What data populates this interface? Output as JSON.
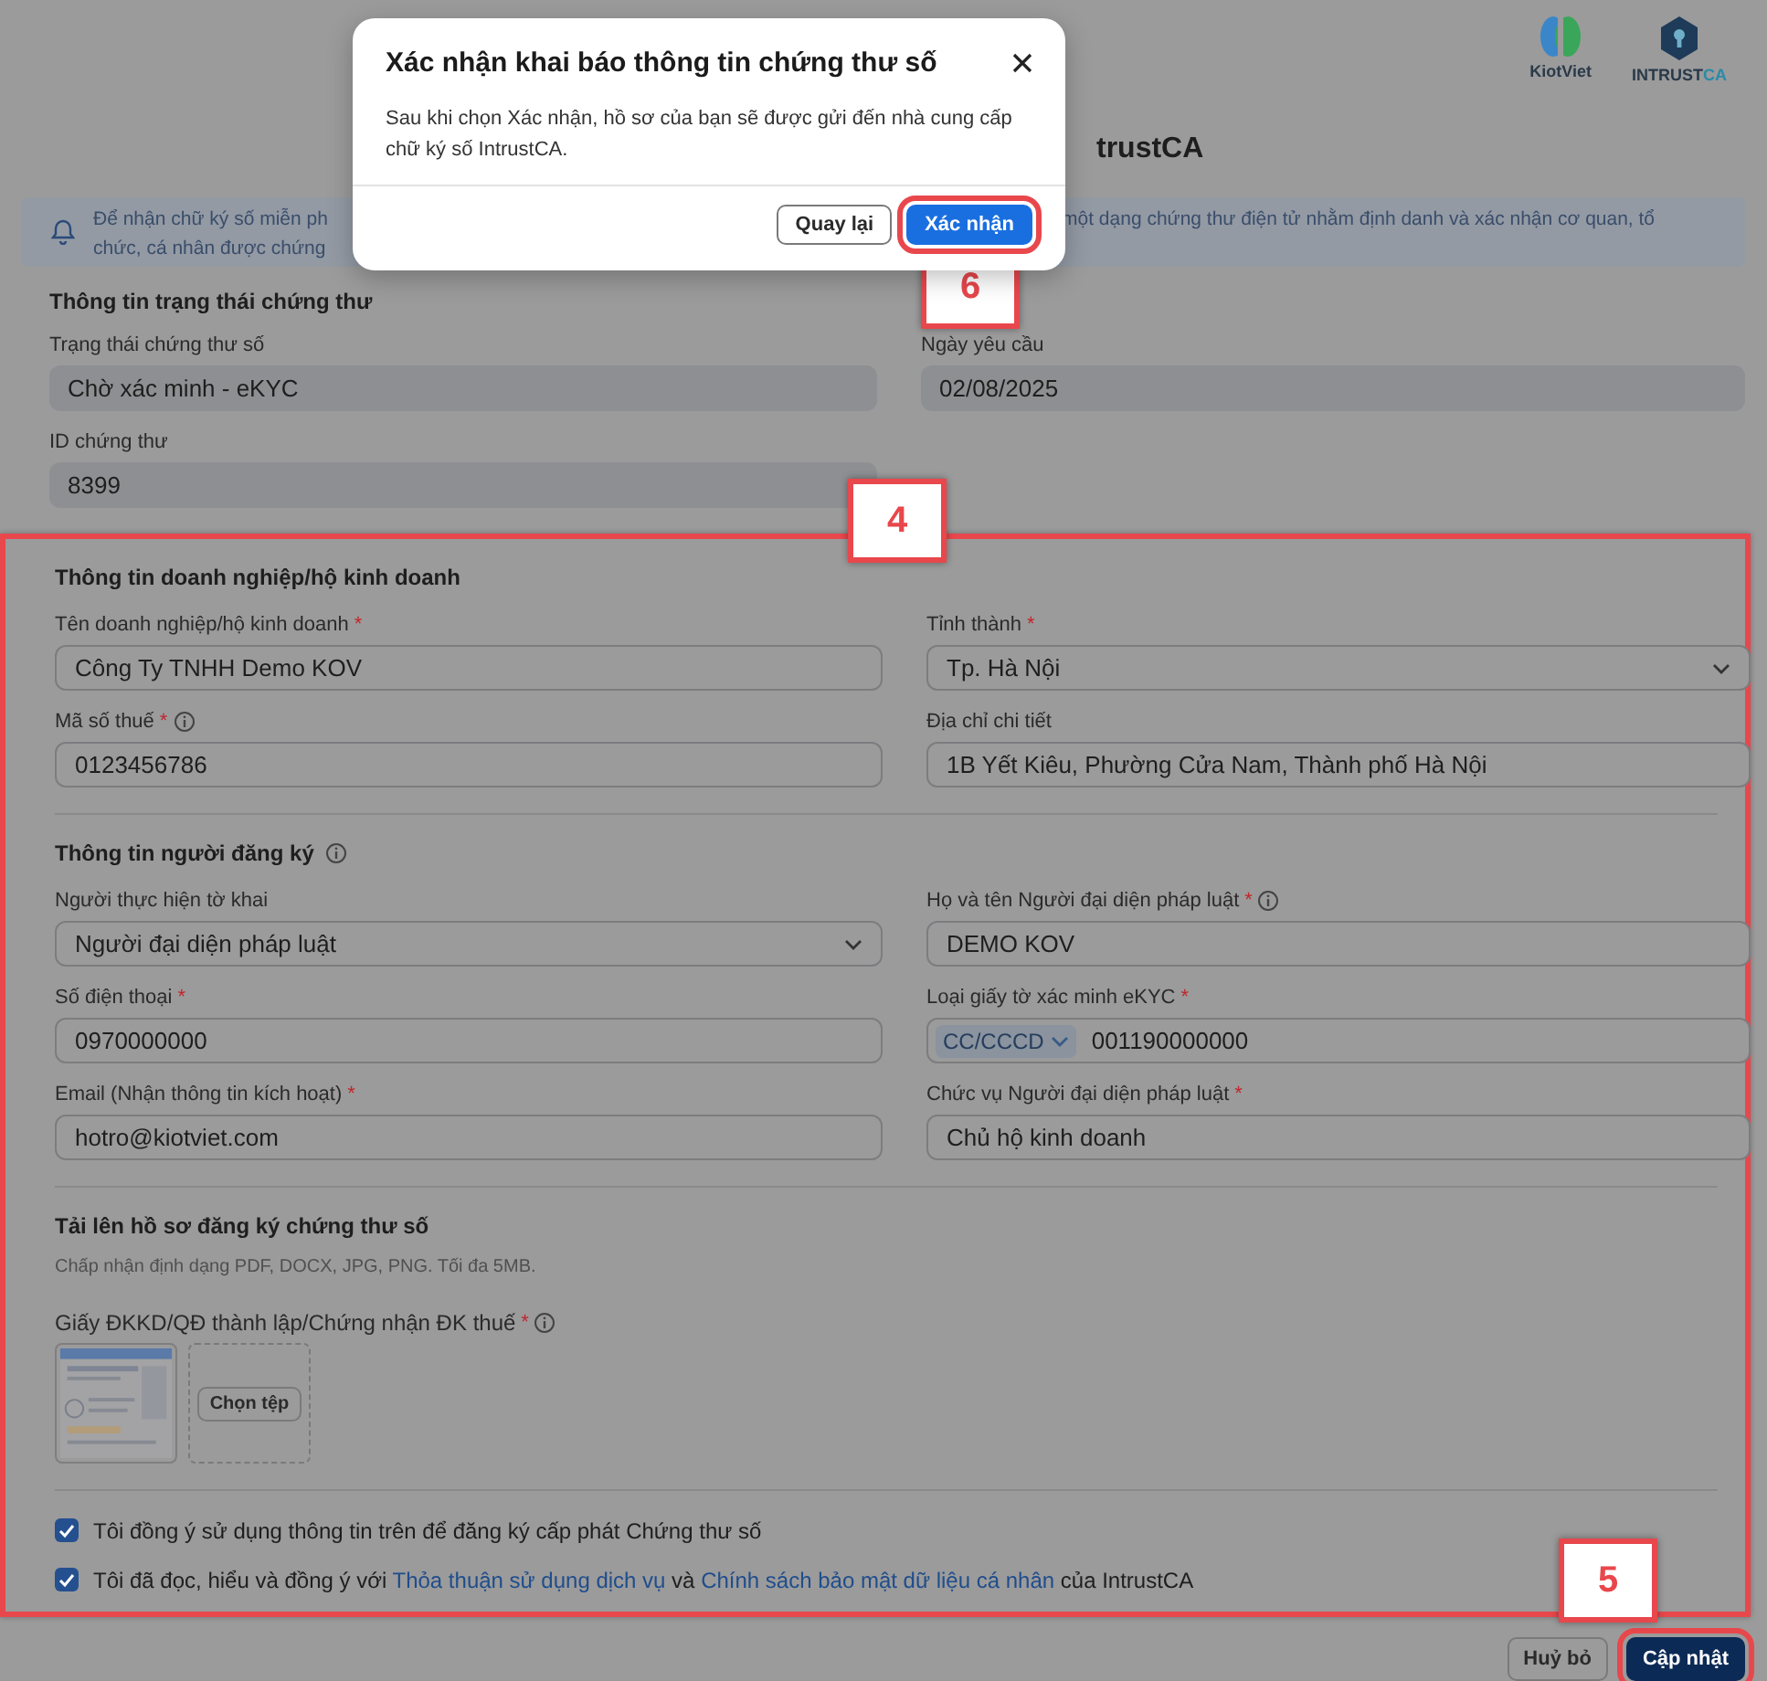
{
  "header": {
    "logos": [
      {
        "kind": "kiotviet",
        "text": "KiotViet"
      },
      {
        "kind": "intrust",
        "text": "INTRUST",
        "accent": "CA"
      }
    ]
  },
  "page_title": "trustCA",
  "notice": {
    "left_lines": [
      "Để nhận chữ ký số miễn ph",
      "chức, cá nhân được chứng"
    ],
    "right_lines": [
      "một dạng chứng thư điện tử nhằm định danh và xác nhận cơ quan, tổ"
    ]
  },
  "status_section": {
    "title": "Thông tin trạng thái chứng thư",
    "fields": [
      {
        "label": "Trạng thái chứng thư số",
        "kind": "readonly",
        "value": "Chờ xác minh - eKYC"
      },
      {
        "label": "Ngày yêu cầu",
        "kind": "readonly",
        "value": "02/08/2025"
      },
      {
        "label": "ID chứng thư",
        "kind": "readonly",
        "value": "8399"
      }
    ]
  },
  "form": {
    "callout": "4",
    "sections": [
      {
        "title": "Thông tin doanh nghiệp/hộ kinh doanh",
        "fields": [
          {
            "label": "Tên doanh nghiệp/hộ kinh doanh",
            "mark": "*",
            "kind": "input",
            "value": "Công Ty TNHH Demo KOV"
          },
          {
            "label": "Tỉnh thành",
            "mark": "*",
            "kind": "select",
            "value": "Tp. Hà Nội"
          },
          {
            "label": "Mã số thuế",
            "mark": "*",
            "info": true,
            "kind": "input",
            "value": "0123456786"
          },
          {
            "label": "Địa chỉ chi tiết",
            "kind": "input",
            "value": "1B Yết Kiêu, Phường Cửa Nam, Thành phố Hà Nội"
          }
        ]
      },
      {
        "title": "Thông tin người đăng ký",
        "info": true,
        "fields": [
          {
            "label": "Người thực hiện tờ khai",
            "kind": "select",
            "value": "Người đại diện pháp luật"
          },
          {
            "label": "Họ và tên Người đại diện pháp luật",
            "mark": "*",
            "info": true,
            "kind": "input",
            "value": "DEMO KOV"
          },
          {
            "label": "Số điện thoại",
            "mark": "*",
            "kind": "input",
            "value": "0970000000"
          },
          {
            "label": "Loại giấy tờ xác minh eKYC",
            "mark": "*",
            "kind": "id_select",
            "prefix": "CC/CCCD",
            "value": "001190000000"
          },
          {
            "label": "Email (Nhận thông tin kích hoạt)",
            "mark": "*",
            "kind": "input",
            "value": "hotro@kiotviet.com"
          },
          {
            "label": "Chức vụ Người đại diện pháp luật",
            "mark": "*",
            "kind": "input",
            "value": "Chủ hộ kinh doanh"
          }
        ]
      }
    ],
    "upload": {
      "title": "Tải lên hồ sơ đăng ký chứng thư số",
      "hint": "Chấp nhận định dạng PDF, DOCX, JPG, PNG. Tối đa 5MB.",
      "label": "Giấy ĐKKD/QĐ thành lập/Chứng nhận ĐK thuế",
      "mark": "*",
      "info": true,
      "choose_button": "Chọn tệp"
    },
    "agreements": [
      {
        "checked": true,
        "segments": [
          {
            "kind": "text",
            "text": "Tôi đồng ý sử dụng thông tin trên để đăng ký cấp phát Chứng thư số"
          }
        ]
      },
      {
        "checked": true,
        "segments": [
          {
            "kind": "text",
            "text": "Tôi đã đọc, hiểu và đồng ý với "
          },
          {
            "kind": "link",
            "text": "Thỏa thuận sử dụng dịch vụ"
          },
          {
            "kind": "text",
            "text": " và "
          },
          {
            "kind": "link",
            "text": "Chính sách bảo mật dữ liệu cá nhân"
          },
          {
            "kind": "text",
            "text": " của IntrustCA"
          }
        ]
      }
    ]
  },
  "actions": {
    "callout": "5",
    "buttons": [
      {
        "label": "Huỷ bỏ",
        "kind": "secondary",
        "highlighted": false
      },
      {
        "label": "Cập nhật",
        "kind": "primary",
        "highlighted": true
      }
    ]
  },
  "modal": {
    "title": "Xác nhận khai báo thông tin chứng thư số",
    "body": "Sau khi chọn Xác nhận, hồ sơ của bạn sẽ được gửi đến nhà cung cấp chữ ký số IntrustCA.",
    "callout": "6",
    "buttons": [
      {
        "label": "Quay lại",
        "kind": "secondary",
        "highlighted": false
      },
      {
        "label": "Xác nhận",
        "kind": "primary",
        "highlighted": true
      }
    ]
  }
}
